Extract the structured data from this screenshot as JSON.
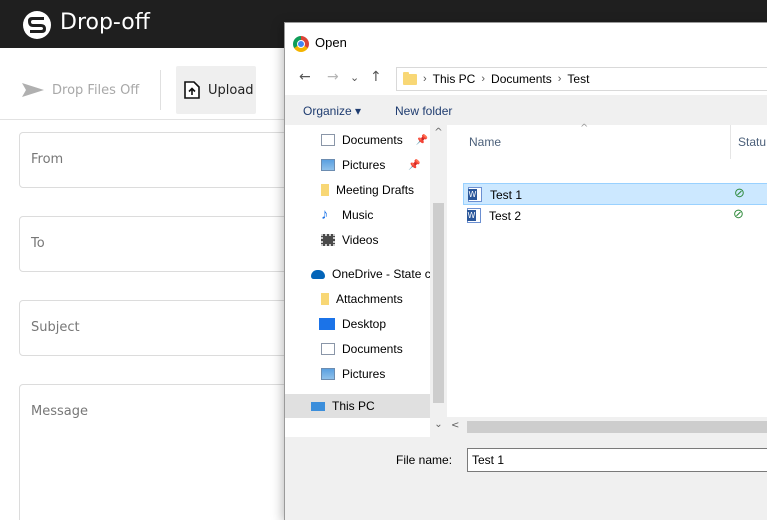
{
  "app": {
    "title": "Drop-off",
    "toolbar": {
      "drop_files_label": "Drop Files Off",
      "upload_label": "Upload"
    },
    "form": {
      "from_placeholder": "From",
      "to_placeholder": "To",
      "subject_placeholder": "Subject",
      "message_placeholder": "Message"
    }
  },
  "dialog": {
    "title": "Open",
    "address": {
      "crumbs": [
        "This PC",
        "Documents",
        "Test"
      ]
    },
    "commands": {
      "organize": "Organize ▾",
      "new_folder": "New folder"
    },
    "nav_items": [
      {
        "label": "Documents",
        "icon": "documents-icon",
        "pinned": true
      },
      {
        "label": "Pictures",
        "icon": "pictures-icon",
        "pinned": true
      },
      {
        "label": "Meeting Drafts",
        "icon": "folder-icon",
        "pinned": false
      },
      {
        "label": "Music",
        "icon": "music-icon",
        "pinned": false
      },
      {
        "label": "Videos",
        "icon": "videos-icon",
        "pinned": false
      },
      {
        "label": "OneDrive - State c",
        "icon": "onedrive-icon",
        "pinned": false
      },
      {
        "label": "Attachments",
        "icon": "folder-icon",
        "pinned": false
      },
      {
        "label": "Desktop",
        "icon": "desktop-icon",
        "pinned": false
      },
      {
        "label": "Documents",
        "icon": "documents-icon",
        "pinned": false
      },
      {
        "label": "Pictures",
        "icon": "pictures-icon",
        "pinned": false
      },
      {
        "label": "This PC",
        "icon": "this-pc-icon",
        "pinned": false
      }
    ],
    "columns": {
      "name": "Name",
      "status": "Statu"
    },
    "files": [
      {
        "name": "Test 1",
        "selected": true
      },
      {
        "name": "Test 2",
        "selected": false
      }
    ],
    "file_name_label": "File name:",
    "file_name_value": "Test 1"
  },
  "colors": {
    "header_bg": "#1f1f1f",
    "selection": "#cce8ff",
    "status_ok": "#2f8a3c"
  }
}
